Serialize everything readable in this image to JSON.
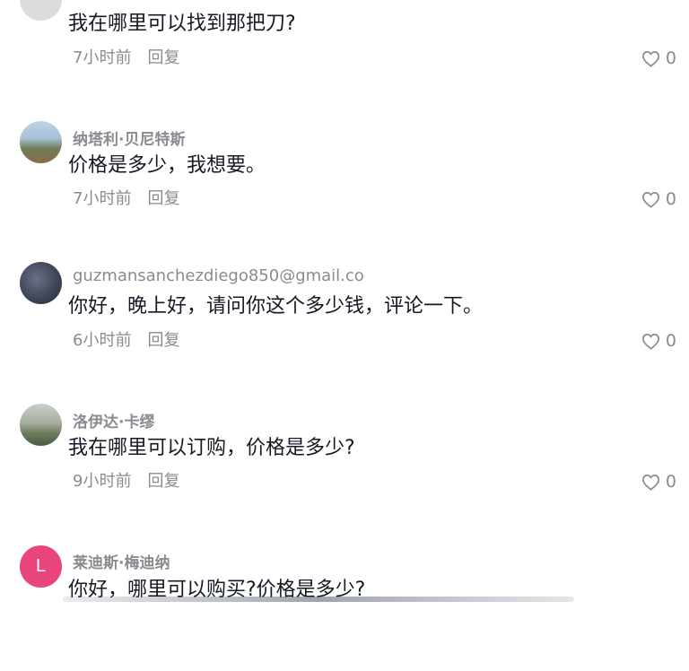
{
  "comments": [
    {
      "username": "",
      "text": "我在哪里可以找到那把刀?",
      "time": "7小时前",
      "reply_label": "回复",
      "likes": "0",
      "avatar_color": "#d9d9d9"
    },
    {
      "username": "纳塔利·贝尼特斯",
      "text": "价格是多少，我想要。",
      "time": "7小时前",
      "reply_label": "回复",
      "likes": "0",
      "avatar_color": "#7fa0b8"
    },
    {
      "username": "guzmansanchezdiego850@gmail.co",
      "text": "你好，晚上好，请问你这个多少钱，评论一下。",
      "time": "6小时前",
      "reply_label": "回复",
      "likes": "0",
      "avatar_color": "#4a4f62"
    },
    {
      "username": "洛伊达·卡缪",
      "text": "我在哪里可以订购，价格是多少?",
      "time": "9小时前",
      "reply_label": "回复",
      "likes": "0",
      "avatar_color": "#9aa48a"
    },
    {
      "username": "莱迪斯·梅迪纳",
      "text": "你好，哪里可以购买?价格是多少?",
      "avatar_letter": "L",
      "avatar_color": "#e8457a"
    }
  ]
}
